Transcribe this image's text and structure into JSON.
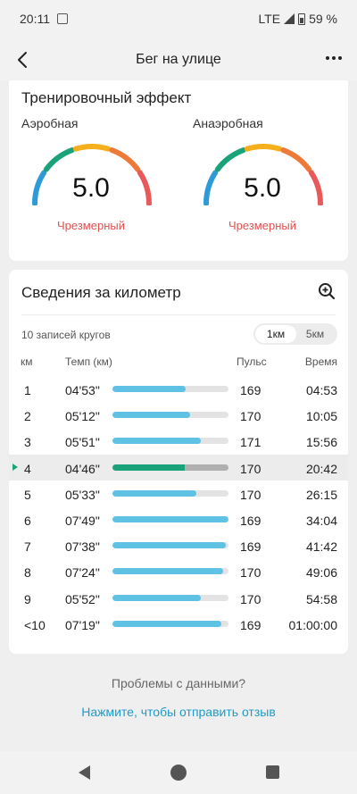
{
  "status_bar": {
    "time": "20:11",
    "network": "LTE",
    "battery": "59 %"
  },
  "header": {
    "title": "Бег на улице"
  },
  "training_effect": {
    "title": "Тренировочный эффект",
    "aerobic": {
      "label": "Аэробная",
      "value": "5.0",
      "status": "Чрезмерный"
    },
    "anaerobic": {
      "label": "Анаэробная",
      "value": "5.0",
      "status": "Чрезмерный"
    }
  },
  "km_details": {
    "title": "Сведения за километр",
    "laps_count": "10 записей кругов",
    "toggle": {
      "option1": "1км",
      "option2": "5км",
      "selected": "1км"
    },
    "columns": {
      "km": "км",
      "pace": "Темп (км)",
      "pulse": "Пульс",
      "time": "Время"
    },
    "rows": [
      {
        "km": "1",
        "pace": "04'53\"",
        "pace_fraction": 0.63,
        "pulse": "169",
        "time": "04:53"
      },
      {
        "km": "2",
        "pace": "05'12\"",
        "pace_fraction": 0.67,
        "pulse": "170",
        "time": "10:05"
      },
      {
        "km": "3",
        "pace": "05'51\"",
        "pace_fraction": 0.76,
        "pulse": "171",
        "time": "15:56"
      },
      {
        "km": "4",
        "pace": "04'46\"",
        "pace_fraction": 0.62,
        "pulse": "170",
        "time": "20:42",
        "active": true
      },
      {
        "km": "5",
        "pace": "05'33\"",
        "pace_fraction": 0.72,
        "pulse": "170",
        "time": "26:15"
      },
      {
        "km": "6",
        "pace": "07'49\"",
        "pace_fraction": 1.0,
        "pulse": "169",
        "time": "34:04"
      },
      {
        "km": "7",
        "pace": "07'38\"",
        "pace_fraction": 0.98,
        "pulse": "169",
        "time": "41:42"
      },
      {
        "km": "8",
        "pace": "07'24\"",
        "pace_fraction": 0.95,
        "pulse": "170",
        "time": "49:06"
      },
      {
        "km": "9",
        "pace": "05'52\"",
        "pace_fraction": 0.76,
        "pulse": "170",
        "time": "54:58"
      },
      {
        "km": "<10",
        "pace": "07'19\"",
        "pace_fraction": 0.94,
        "pulse": "169",
        "time": "01:00:00"
      }
    ]
  },
  "feedback": {
    "question": "Проблемы с данными?",
    "link": "Нажмите, чтобы отправить отзыв"
  },
  "colors": {
    "accent_green": "#1aa37a",
    "bar_blue": "#5fc1e4",
    "warning_red": "#e05050",
    "link_blue": "#1e9bc9",
    "gauge_segments": [
      "#2f9ad8",
      "#1aa37a",
      "#f5ae1c",
      "#ee7a3a",
      "#e8595a"
    ]
  }
}
